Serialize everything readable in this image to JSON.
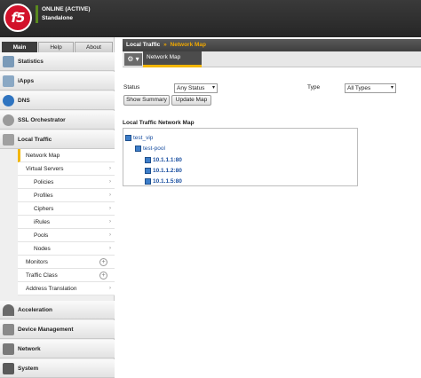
{
  "banner": {
    "logo": "f5",
    "status": "ONLINE (ACTIVE)",
    "mode": "Standalone"
  },
  "tabs": [
    {
      "label": "Main",
      "active": true
    },
    {
      "label": "Help",
      "active": false
    },
    {
      "label": "About",
      "active": false
    }
  ],
  "sections": [
    {
      "label": "Statistics",
      "icon": "statistics-icon"
    },
    {
      "label": "iApps",
      "icon": "iapps-icon"
    },
    {
      "label": "DNS",
      "icon": "dns-icon"
    },
    {
      "label": "SSL Orchestrator",
      "icon": "ssl-orchestrator-icon"
    },
    {
      "label": "Local Traffic",
      "icon": "local-traffic-icon"
    },
    {
      "label": "Acceleration",
      "icon": "acceleration-icon"
    },
    {
      "label": "Device Management",
      "icon": "device-management-icon"
    },
    {
      "label": "Network",
      "icon": "network-icon"
    },
    {
      "label": "System",
      "icon": "system-icon"
    }
  ],
  "local_traffic_items": [
    {
      "label": "Network Map",
      "active": true
    },
    {
      "label": "Virtual Servers",
      "arrow": true
    },
    {
      "label": "Policies",
      "arrow": true,
      "indent": true
    },
    {
      "label": "Profiles",
      "arrow": true,
      "indent": true
    },
    {
      "label": "Ciphers",
      "arrow": true,
      "indent": true
    },
    {
      "label": "iRules",
      "arrow": true,
      "indent": true
    },
    {
      "label": "Pools",
      "arrow": true,
      "indent": true
    },
    {
      "label": "Nodes",
      "arrow": true,
      "indent": true
    },
    {
      "label": "Monitors",
      "plus": true
    },
    {
      "label": "Traffic Class",
      "plus": true
    },
    {
      "label": "Address Translation",
      "arrow": true
    }
  ],
  "breadcrumb": {
    "section": "Local Traffic",
    "separator": "»",
    "current": "Network Map"
  },
  "toolbar": {
    "gear": "⚙ ▾",
    "active_tab": "Network Map"
  },
  "filter": {
    "status_label": "Status",
    "status_value": "Any Status",
    "type_label": "Type",
    "type_value": "All Types"
  },
  "buttons": {
    "show_summary": "Show Summary",
    "update_map": "Update Map"
  },
  "network_map": {
    "title": "Local Traffic Network Map",
    "virtual_server": "test_vip",
    "pool": "test-pool",
    "members": [
      "10.1.1.1:80",
      "10.1.1.2:80",
      "10.1.1.5:80"
    ]
  },
  "colors": {
    "accent": "#f3b600",
    "logo_red": "#d2112a",
    "link_blue": "#1a4fa0"
  }
}
